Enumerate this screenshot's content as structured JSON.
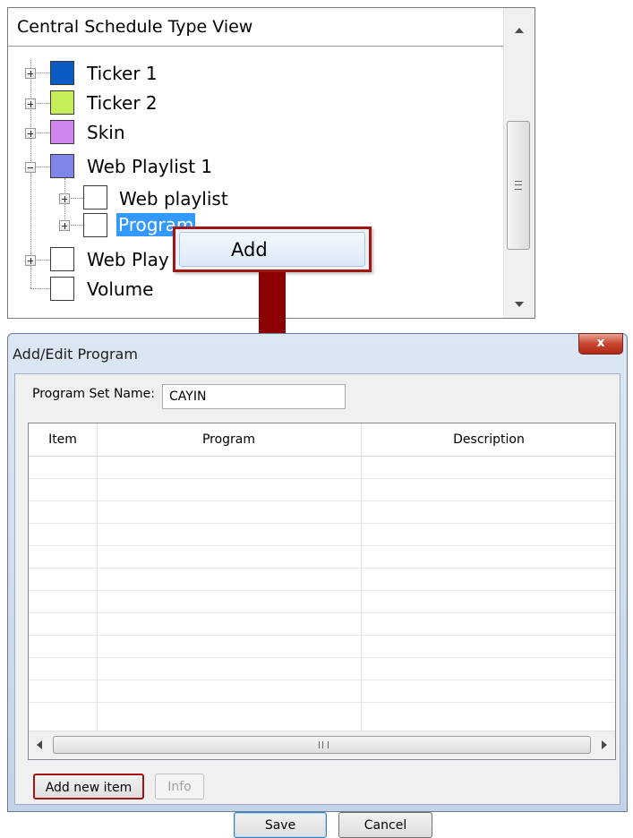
{
  "tree": {
    "header": "Central Schedule Type View",
    "items": [
      {
        "label": "Ticker 1",
        "color": "#0a5bc2",
        "expander": "plus"
      },
      {
        "label": "Ticker 2",
        "color": "#56a8f4",
        "expander": "plus"
      },
      {
        "label": "Skin",
        "color": "#c5ef57",
        "expander": "plus"
      },
      {
        "label": "Web Playlist 1",
        "color": "#cf85ef",
        "expander": "minus"
      },
      {
        "label": "Web playlist",
        "color": "#cf85ef",
        "expander": "plus"
      },
      {
        "label": "Program",
        "color": "#cf85ef",
        "expander": "plus",
        "selected": true
      },
      {
        "label": "Web Play",
        "color": "#7f86e8",
        "expander": "plus"
      },
      {
        "label": "Volume",
        "color": "#b98e7c",
        "expander": "none"
      }
    ]
  },
  "context_menu": {
    "add_label": "Add"
  },
  "dialog": {
    "title": "Add/Edit Program",
    "close_label": "x",
    "set_name_label": "Program Set Name:",
    "set_name_value": "CAYIN",
    "columns": [
      "Item",
      "Program",
      "Description"
    ],
    "scrollbar_grip": "III",
    "add_new_item_label": "Add new item",
    "info_label": "Info",
    "save_label": "Save",
    "cancel_label": "Cancel"
  },
  "highlight_color": "#a31515",
  "selection_color": "#3399ff"
}
